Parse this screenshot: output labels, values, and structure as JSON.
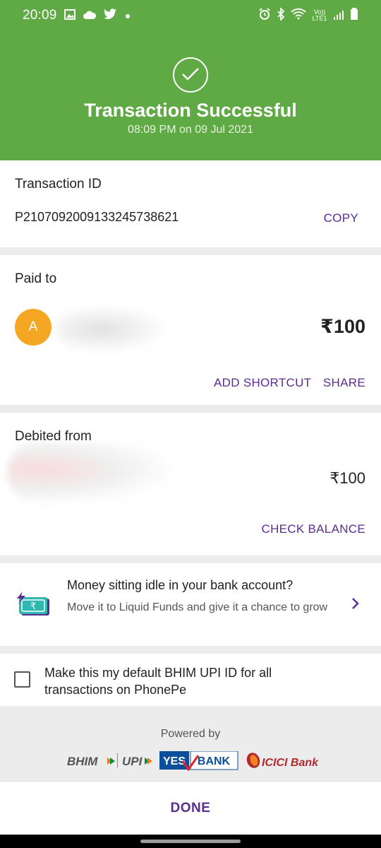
{
  "status_bar": {
    "time": "20:09",
    "network_label": "Vo)) LTE1",
    "left_icons": [
      "gallery-icon",
      "cloud-icon",
      "twitter-icon",
      "dot-icon"
    ],
    "right_icons": [
      "alarm-icon",
      "bluetooth-icon",
      "wifi-icon",
      "signal-icon",
      "battery-icon"
    ]
  },
  "header": {
    "title": "Transaction Successful",
    "subtitle": "08:09 PM on 09 Jul 2021",
    "icon": "check-circle-icon",
    "background_color": "#5faa44"
  },
  "transaction": {
    "label": "Transaction ID",
    "id": "P2107092009133245738621",
    "copy_label": "COPY"
  },
  "paid_to": {
    "label": "Paid to",
    "avatar_initial": "A",
    "avatar_color": "#f5a623",
    "amount": "₹100",
    "add_shortcut_label": "ADD SHORTCUT",
    "share_label": "SHARE"
  },
  "debited_from": {
    "label": "Debited from",
    "amount": "₹100",
    "check_balance_label": "CHECK BALANCE"
  },
  "promo": {
    "title": "Money sitting idle in your bank account?",
    "subtitle": "Move it to Liquid Funds and give it a chance to grow",
    "icon": "money-bolt-icon"
  },
  "default_upi": {
    "text": "Make this my default BHIM UPI ID for all transactions on PhonePe",
    "checked": false
  },
  "powered_by": {
    "label": "Powered by",
    "logos": {
      "bhim": "BHIM",
      "upi": "UPI",
      "yes": "YES",
      "bank": "BANK",
      "icici": "ICICI Bank"
    }
  },
  "footer": {
    "done_label": "DONE"
  },
  "colors": {
    "accent": "#5b2c91",
    "success": "#5faa44"
  }
}
